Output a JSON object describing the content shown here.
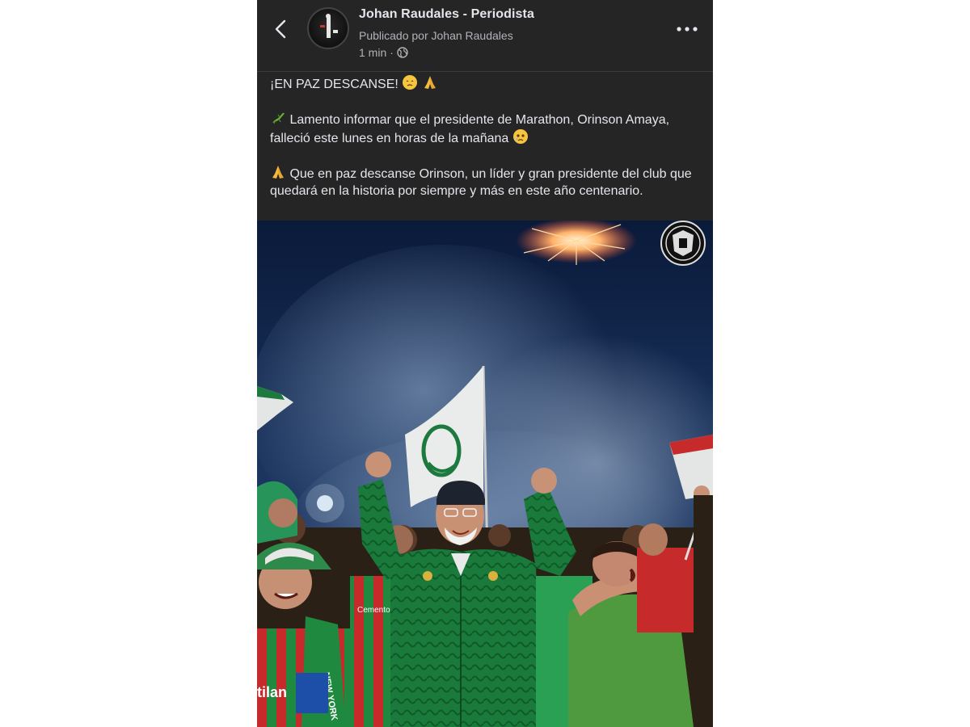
{
  "header": {
    "page_name": "Johan Raudales - Periodista",
    "posted_by": "Publicado por Johan Raudales",
    "time": "1 min",
    "separator": "·"
  },
  "post": {
    "headline": "¡EN PAZ DESCANSE!",
    "paragraph_1": "Lamento informar que el presidente de Marathon, Orinson Amaya, falleció este lunes en horas de la mañana",
    "paragraph_2": "Que en paz descanse Orinson, un líder y gran presidente del club que quedará en la historia por siempre y más en este año centenario."
  },
  "photo": {
    "jersey_text_1": "Cementos",
    "jersey_text_2": "NEW YORK",
    "jersey_text_3": "tilan"
  },
  "icons": {
    "back": "chevron-left-icon",
    "more": "more-dots-icon",
    "globe": "globe-icon",
    "sad_face": "sad-face-emoji",
    "pray": "praying-hands-emoji",
    "lizard": "lizard-emoji",
    "crying_face": "crying-face-emoji"
  },
  "colors": {
    "background": "#252526",
    "primary_text": "#e4e6eb",
    "secondary_text": "#b0b3b8",
    "jacket_green": "#1d7a3e",
    "jersey_red": "#c42a2a"
  }
}
